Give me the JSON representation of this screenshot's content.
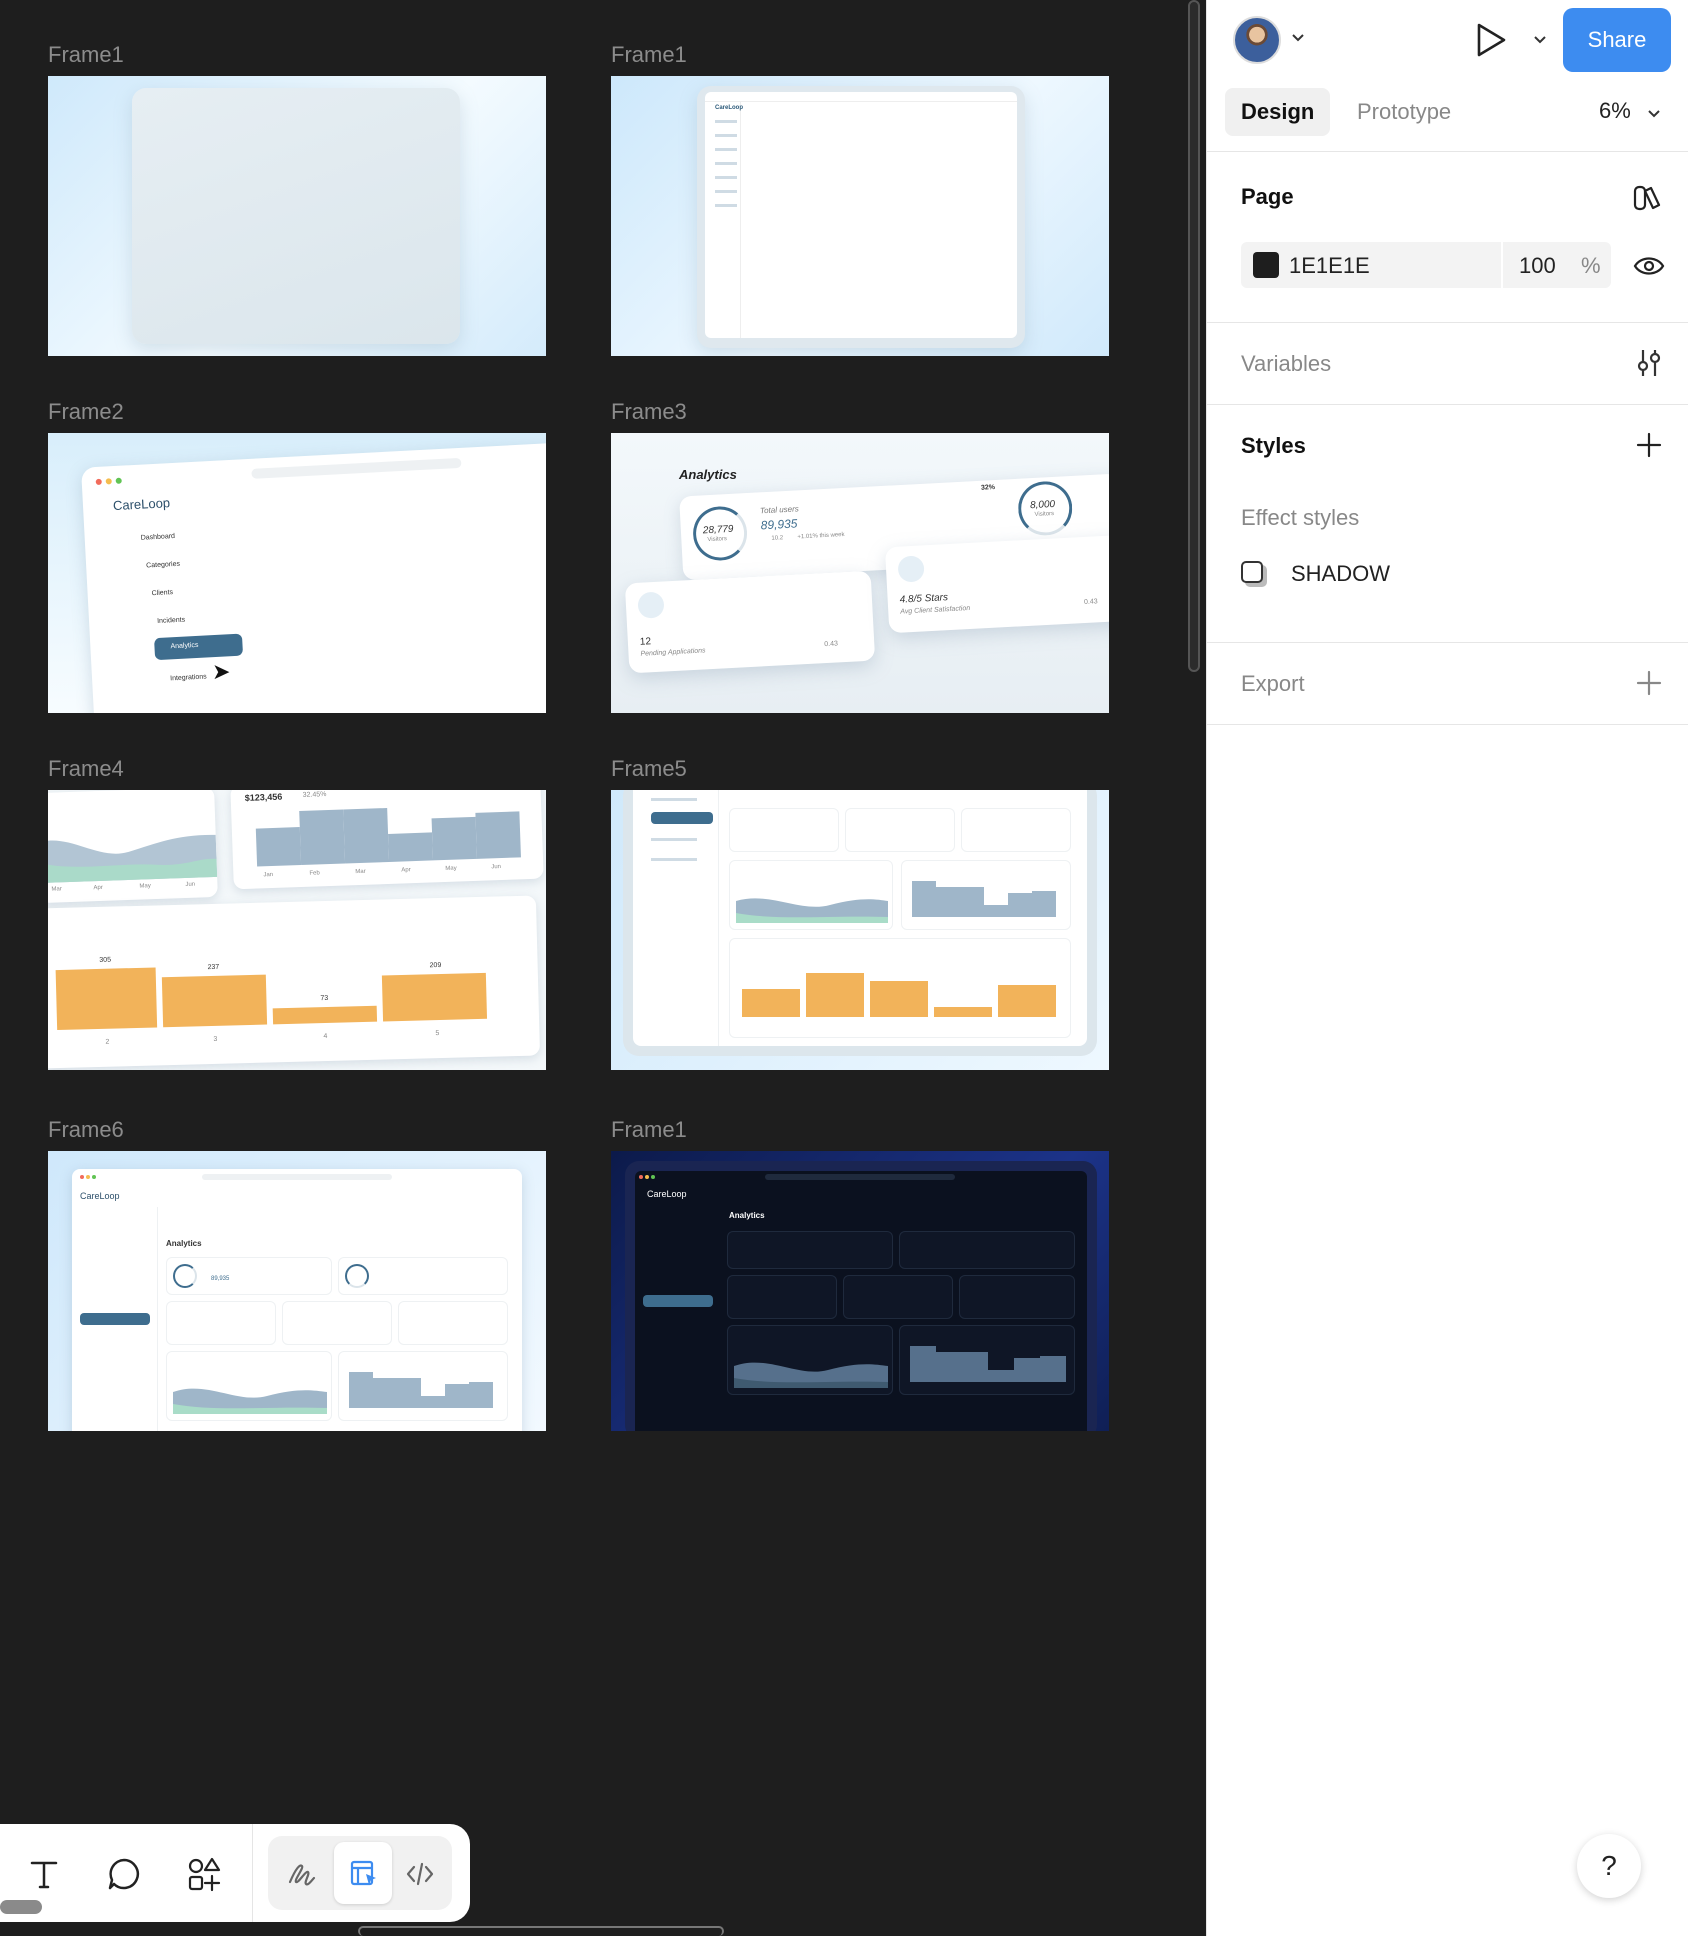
{
  "canvas": {
    "frames": [
      {
        "label": "Frame1"
      },
      {
        "label": "Frame1"
      },
      {
        "label": "Frame2"
      },
      {
        "label": "Frame3"
      },
      {
        "label": "Frame4"
      },
      {
        "label": "Frame5"
      },
      {
        "label": "Frame6"
      },
      {
        "label": "Frame1"
      }
    ],
    "thumbnail_text": {
      "careloop": "CareLoop",
      "dashboard": "Dashboard",
      "categories": "Categories",
      "clients": "Clients",
      "incidents": "Incidents",
      "analytics": "Analytics",
      "integrations": "Integrations",
      "analytics_title": "Analytics",
      "visitors_value": "28,779",
      "visitors_label": "Visitors",
      "total_users_label": "Total users",
      "total_users_value": "89,935",
      "total_users_change": "10.2",
      "total_users_week": "+1.01% this week",
      "badge_pct": "32%",
      "visitors2_value": "8,000",
      "visitors2_label": "Visitors",
      "pending_value": "12",
      "pending_label": "Pending Applications",
      "pending_change": "0.43",
      "stars_value": "4.8/5 Stars",
      "stars_label": "Avg Client Satisfaction",
      "stars_change": "0.43",
      "revenue_value": "$123,456",
      "revenue_change": "32.45%",
      "months": [
        "Mar",
        "Apr",
        "May",
        "Jun"
      ],
      "months2": [
        "Jan",
        "Feb",
        "Mar",
        "Apr",
        "May",
        "Jun"
      ],
      "bar_values": [
        "305",
        "237",
        "73",
        "209"
      ],
      "bar_cats": [
        "2",
        "3",
        "4",
        "5"
      ]
    }
  },
  "panel": {
    "share_label": "Share",
    "tabs": [
      {
        "label": "Design"
      },
      {
        "label": "Prototype"
      }
    ],
    "zoom": "6%",
    "page": {
      "title": "Page",
      "hex": "1E1E1E",
      "opacity": "100",
      "opacity_unit": "%",
      "swatch_color": "#1e1e1e"
    },
    "variables_title": "Variables",
    "styles_title": "Styles",
    "effect_styles_title": "Effect styles",
    "effect_style_name": "SHADOW",
    "export_title": "Export",
    "help_label": "?"
  },
  "colors": {
    "canvas_bg": "#1e1e1e",
    "accent": "#3d8cf0",
    "bar_orange": "#f2b35a",
    "chart_blue": "#9fb6c9",
    "chart_teal": "#a9dcc8",
    "nav_active": "#3e6d8e",
    "dark_frame_bg": "#0f1f55"
  }
}
